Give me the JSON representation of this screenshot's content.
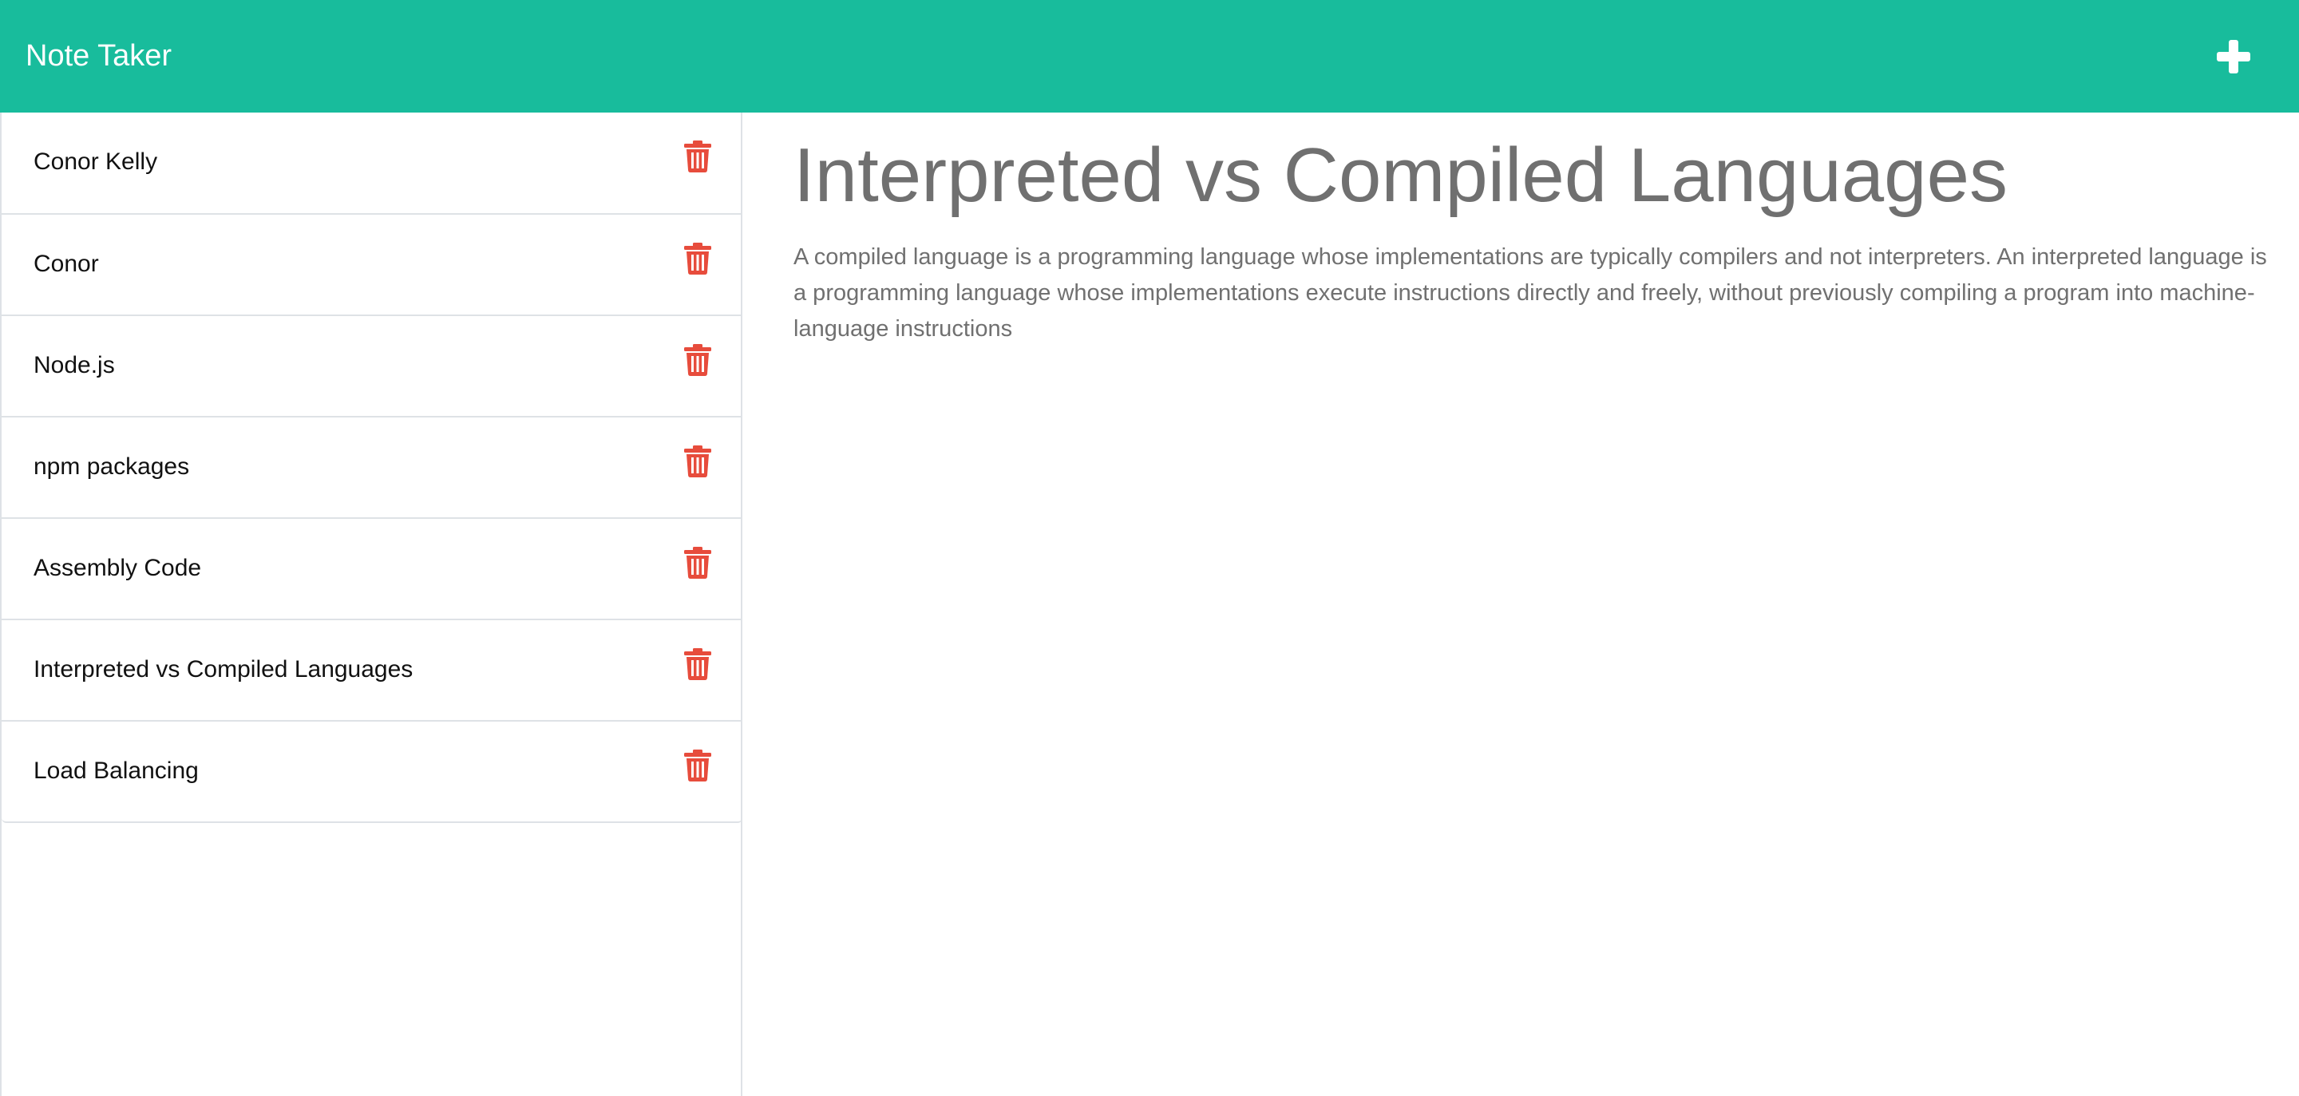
{
  "header": {
    "brand": "Note Taker",
    "new_note_icon": "plus-icon"
  },
  "colors": {
    "navbar": "#18bc9c",
    "delete_icon": "#e74c3c",
    "heading_text": "#707070",
    "list_text": "#111111"
  },
  "sidebar": {
    "delete_icon": "trash-icon",
    "notes": [
      {
        "title": "Conor Kelly"
      },
      {
        "title": "Conor"
      },
      {
        "title": "Node.js"
      },
      {
        "title": "npm packages"
      },
      {
        "title": "Assembly Code"
      },
      {
        "title": "Interpreted vs Compiled Languages"
      },
      {
        "title": "Load Balancing"
      }
    ]
  },
  "active_note": {
    "title": "Interpreted vs Compiled Languages",
    "text": "A compiled language is a programming language whose implementations are typically compilers and not interpreters. An interpreted language is a programming language whose implementations execute instructions directly and freely, without previously compiling a program into machine-language instructions"
  }
}
